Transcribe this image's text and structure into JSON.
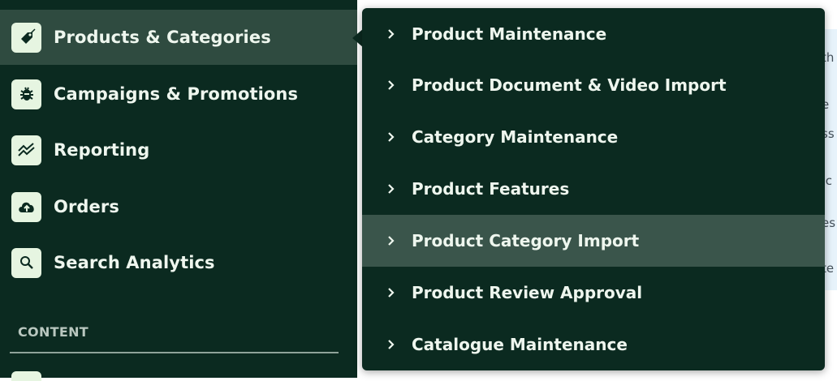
{
  "sidebar": {
    "items": [
      {
        "label": "Products & Categories",
        "icon": "tag-icon",
        "active": true
      },
      {
        "label": "Campaigns & Promotions",
        "icon": "bug-icon"
      },
      {
        "label": "Reporting",
        "icon": "chart-line-icon"
      },
      {
        "label": "Orders",
        "icon": "cloud-upload-icon"
      },
      {
        "label": "Search Analytics",
        "icon": "search-icon"
      }
    ],
    "section_label": "CONTENT"
  },
  "submenu": {
    "items": [
      {
        "label": "Product Maintenance"
      },
      {
        "label": "Product Document & Video Import"
      },
      {
        "label": "Category Maintenance"
      },
      {
        "label": "Product Features"
      },
      {
        "label": "Product Category Import",
        "hovered": true
      },
      {
        "label": "Product Review Approval"
      },
      {
        "label": "Catalogue Maintenance"
      }
    ]
  },
  "background_fragments": [
    "th",
    "e",
    "ss",
    ".c",
    "es",
    "te"
  ],
  "colors": {
    "sidebar_bg": "#0b2a20",
    "active_bg": "#2f4b40",
    "hover_bg": "#3a554b",
    "icon_tile": "#e6f5e1",
    "text": "#eef6ee"
  }
}
